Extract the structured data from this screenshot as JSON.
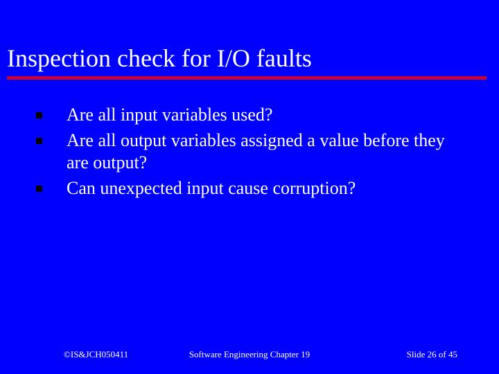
{
  "title": "Inspection check for I/O faults",
  "bullets": [
    "Are all input variables used?",
    "Are all output variables assigned a value before they are output?",
    "Can unexpected input cause corruption?"
  ],
  "footer": {
    "left": "©IS&JCH050411",
    "center": "Software Engineering  Chapter 19",
    "right": "Slide 26 of 45"
  }
}
